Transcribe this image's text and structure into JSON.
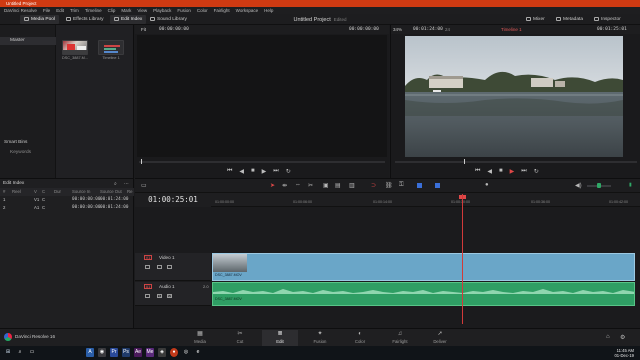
{
  "window": {
    "title": "Untitled Project"
  },
  "menu": [
    "DaVinci Resolve",
    "File",
    "Edit",
    "Trim",
    "Timeline",
    "Clip",
    "Mark",
    "View",
    "Playback",
    "Fusion",
    "Color",
    "Fairlight",
    "Workspace",
    "Help"
  ],
  "toolbar": {
    "media_pool": "Media Pool",
    "effects_library": "Effects Library",
    "edit_index": "Edit Index",
    "sound_library": "Sound Library",
    "mixer": "Mixer",
    "metadata": "Metadata",
    "inspector": "Inspector"
  },
  "project": {
    "title": "Untitled Project",
    "status": "Edited"
  },
  "media_pool": {
    "bin": "Master",
    "smart_bins": "Smart Bins",
    "keywords": "Keywords",
    "clips": [
      {
        "label": "DSC_3887.M..."
      },
      {
        "label": "Timeline 1"
      }
    ]
  },
  "edit_index": {
    "title": "Edit Index",
    "columns": [
      "#",
      "Reel",
      "V",
      "C",
      "Dur",
      "Source In",
      "Source Out",
      "Re"
    ],
    "rows": [
      {
        "num": "1",
        "v": "V1",
        "c": "C",
        "source_in": "00:00:00:00",
        "source_out": "00:01:24:00"
      },
      {
        "num": "2",
        "v": "A1",
        "c": "C",
        "source_in": "00:00:00:00",
        "source_out": "00:01:24:00"
      }
    ]
  },
  "source_viewer": {
    "fit": "Fit",
    "timecode": "00:00:00:00",
    "timecode_right": "00:00:00:00"
  },
  "timeline_viewer": {
    "zoom": "34%",
    "duration": "00:01:24:00",
    "duration_suffix": "24",
    "timeline_name": "Timeline 1",
    "timecode": "00:01:25:01"
  },
  "timeline": {
    "timecode": "01:00:25:01",
    "ruler": [
      "01:00:00:00",
      "01:00:06:00",
      "01:00:14:00",
      "01:00:30:00",
      "01:00:36:00",
      "01:00:42:00"
    ],
    "tracks": {
      "video": {
        "id": "V1",
        "name": "Video 1",
        "clip": "DSC_3887.MOV"
      },
      "audio": {
        "id": "A1",
        "name": "Audio 1",
        "channels": "2.0",
        "clip": "DSC_3887.MOV"
      }
    }
  },
  "pages": [
    {
      "name": "Media",
      "glyph": "▦"
    },
    {
      "name": "Cut",
      "glyph": "✂"
    },
    {
      "name": "Edit",
      "glyph": "≣"
    },
    {
      "name": "Fusion",
      "glyph": "✦"
    },
    {
      "name": "Color",
      "glyph": "◐"
    },
    {
      "name": "Fairlight",
      "glyph": "♫"
    },
    {
      "name": "Deliver",
      "glyph": "➚"
    }
  ],
  "app_name": "DaVinci Resolve 16",
  "taskbar": {
    "time": "11:45 AM",
    "date": "01-Dec-19"
  },
  "colors": {
    "title_bar": "#cf3a12",
    "video_clip": "#6aa6c8",
    "audio_clip": "#2f9e64",
    "playhead": "#d23a3a",
    "accent_blue": "#3a6fd8"
  }
}
